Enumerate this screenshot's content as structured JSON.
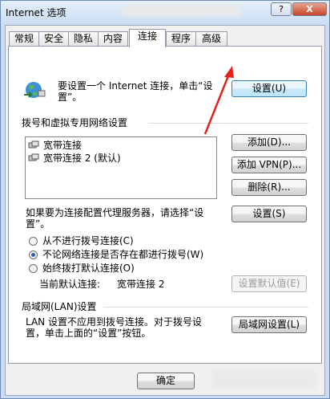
{
  "window": {
    "title": "Internet 选项",
    "help_label": "?",
    "close_label": "X"
  },
  "tabs": [
    {
      "label": "常规"
    },
    {
      "label": "安全"
    },
    {
      "label": "隐私"
    },
    {
      "label": "内容"
    },
    {
      "label": "连接"
    },
    {
      "label": "程序"
    },
    {
      "label": "高级"
    }
  ],
  "active_tab": "连接",
  "setup": {
    "text_line1": "要设置一个 Internet 连接，单击“设",
    "text_line2": "置”。",
    "button_label": "设置(U)"
  },
  "dialup": {
    "group_label": "拨号和虚拟专用网络设置",
    "connections": [
      {
        "label": "宽带连接"
      },
      {
        "label": "宽带连接 2 (默认)"
      }
    ],
    "add_label": "添加(D)...",
    "add_vpn_label": "添加 VPN(P)...",
    "remove_label": "删除(R)...",
    "proxy_text_line1": "如果要为连接配置代理服务器，请选择“设",
    "proxy_text_line2": "置”。",
    "settings_label": "设置(S)",
    "options": [
      {
        "label": "从不进行拨号连接(C)",
        "checked": false
      },
      {
        "label": "不论网络连接是否存在都进行拨号(W)",
        "checked": true
      },
      {
        "label": "始终拨打默认连接(O)",
        "checked": false
      }
    ],
    "current_default_label": "当前默认连接:",
    "current_default_value": "宽带连接 2",
    "set_default_label": "设置默认值(E)"
  },
  "lan": {
    "group_label": "局域网(LAN)设置",
    "text_line1": "LAN 设置不应用到拨号连接。对于拨号设",
    "text_line2": "置，单击上面的“设置”按钮。",
    "button_label": "局域网设置(L)"
  },
  "footer": {
    "ok_label": "确定"
  },
  "colors": {
    "annotation_arrow": "#e3231c",
    "title_bar": "#cddff5",
    "close_button": "#c7442a"
  }
}
